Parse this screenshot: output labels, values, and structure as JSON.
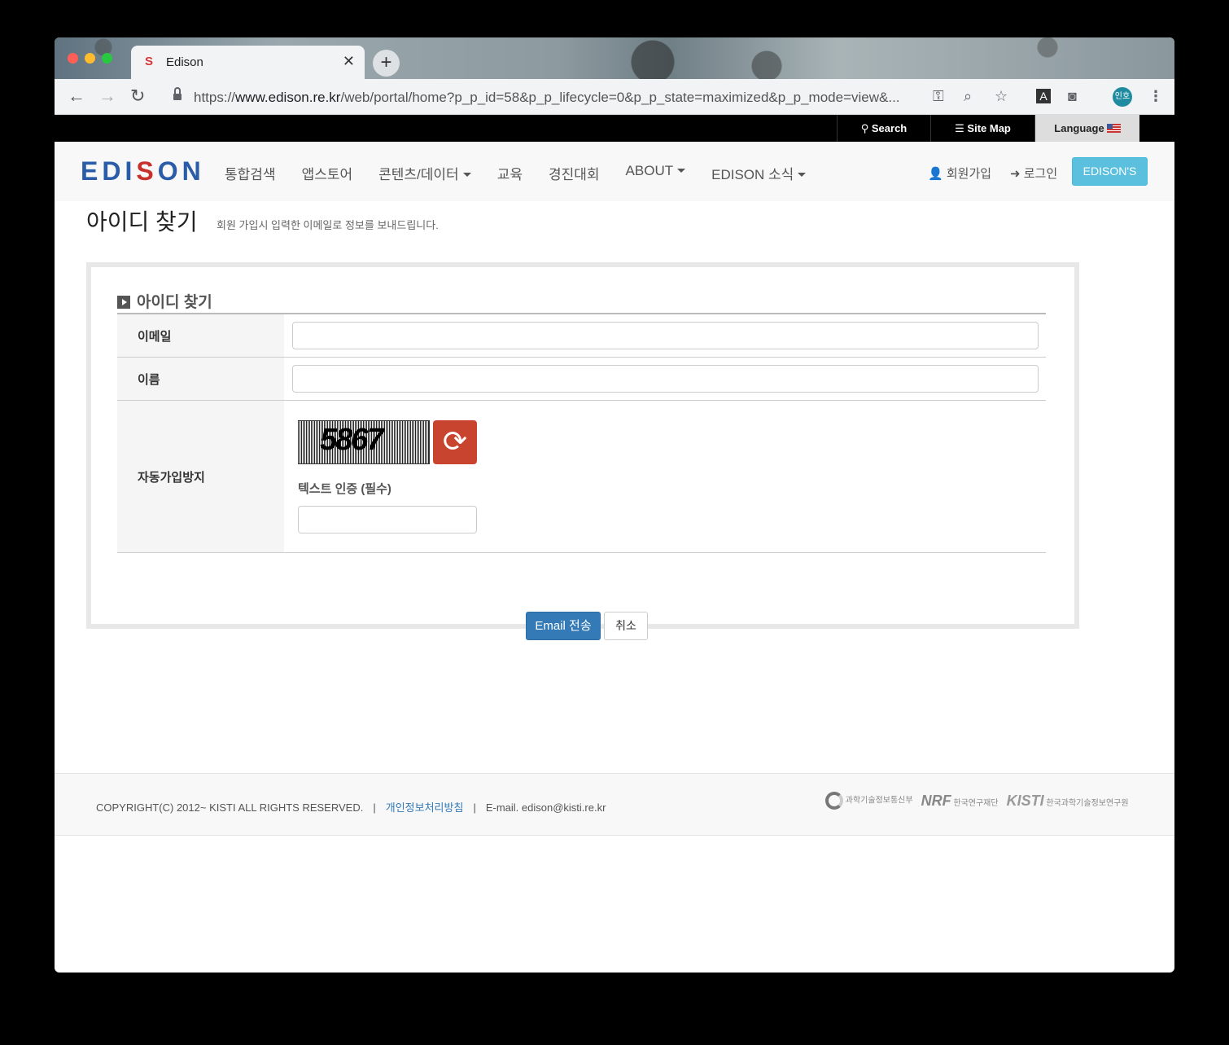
{
  "browser": {
    "tab_title": "Edison",
    "url_scheme": "https://",
    "url_host": "www.edison.re.kr",
    "url_path": "/web/portal/home?p_p_id=58&p_p_lifecycle=0&p_p_state=maximized&p_p_mode=view&...",
    "profile_label": "인호"
  },
  "topstrip": {
    "search": "Search",
    "sitemap": "Site Map",
    "language": "Language"
  },
  "header": {
    "logo_text_1": "EDI",
    "logo_text_s": "S",
    "logo_text_2": "ON",
    "menu": [
      "통합검색",
      "앱스토어",
      "콘텐츠/데이터",
      "교육",
      "경진대회",
      "ABOUT",
      "EDISON 소식"
    ],
    "signup": "회원가입",
    "login": "로그인",
    "edisons_button": "EDISON'S"
  },
  "page": {
    "title": "아이디 찾기",
    "subtitle": "회원 가입시 입력한 이메일로 정보를 보내드립니다."
  },
  "form": {
    "section_title": "아이디 찾기",
    "email_label": "이메일",
    "email_value": "",
    "name_label": "이름",
    "name_value": "",
    "captcha_label": "자동가입방지",
    "captcha_text": "5867",
    "captcha_input_label": "텍스트 인증 (필수)",
    "captcha_value": "",
    "submit_label": "Email 전송",
    "cancel_label": "취소"
  },
  "footer": {
    "copyright": "COPYRIGHT(C) 2012~ KISTI ALL RIGHTS RESERVED.",
    "privacy": "개인정보처리방침",
    "email": "E-mail. edison@kisti.re.kr",
    "partner_1": "과학기술정보통신부",
    "partner_2_mark": "NRF",
    "partner_2": "한국연구재단",
    "partner_3_mark": "KISTI",
    "partner_3": "한국과학기술정보연구원"
  }
}
